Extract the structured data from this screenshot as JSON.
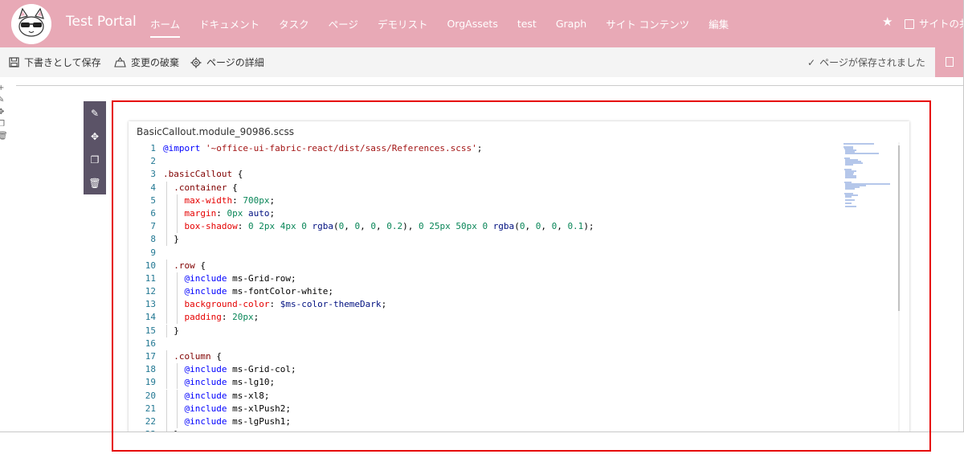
{
  "header": {
    "site_title": "Test Portal",
    "nav": [
      "ホーム",
      "ドキュメント",
      "タスク",
      "ページ",
      "デモリスト",
      "OrgAssets",
      "test",
      "Graph",
      "サイト コンテンツ",
      "編集"
    ],
    "active_nav": "ホーム",
    "share_label": "サイトの共",
    "brand_color": "#e8a9b6"
  },
  "commandbar": {
    "save_draft": "下書きとして保存",
    "discard": "変更の破棄",
    "page_details": "ページの詳細",
    "saved_status": "ページが保存されました"
  },
  "webpart": {
    "filename": "BasicCallout.module_90986.scss"
  },
  "code_lines": [
    [
      [
        "at",
        "@import"
      ],
      [
        "plain",
        " "
      ],
      [
        "str",
        "'~office-ui-fabric-react/dist/sass/References.scss'"
      ],
      [
        "plain",
        ";"
      ]
    ],
    [],
    [
      [
        "sel",
        ".basicCallout"
      ],
      [
        "plain",
        " {"
      ]
    ],
    [
      [
        "plain",
        "  "
      ],
      [
        "sel",
        ".container"
      ],
      [
        "plain",
        " {"
      ]
    ],
    [
      [
        "plain",
        "    "
      ],
      [
        "prop",
        "max-width"
      ],
      [
        "plain",
        ": "
      ],
      [
        "num",
        "700px"
      ],
      [
        "plain",
        ";"
      ]
    ],
    [
      [
        "plain",
        "    "
      ],
      [
        "prop",
        "margin"
      ],
      [
        "plain",
        ": "
      ],
      [
        "num",
        "0px"
      ],
      [
        "plain",
        " "
      ],
      [
        "var",
        "auto"
      ],
      [
        "plain",
        ";"
      ]
    ],
    [
      [
        "plain",
        "    "
      ],
      [
        "prop",
        "box-shadow"
      ],
      [
        "plain",
        ": "
      ],
      [
        "num",
        "0 2px 4px 0"
      ],
      [
        "plain",
        " "
      ],
      [
        "var",
        "rgba"
      ],
      [
        "plain",
        "("
      ],
      [
        "num",
        "0"
      ],
      [
        "plain",
        ", "
      ],
      [
        "num",
        "0"
      ],
      [
        "plain",
        ", "
      ],
      [
        "num",
        "0"
      ],
      [
        "plain",
        ", "
      ],
      [
        "num",
        "0.2"
      ],
      [
        "plain",
        "), "
      ],
      [
        "num",
        "0 25px 50px 0"
      ],
      [
        "plain",
        " "
      ],
      [
        "var",
        "rgba"
      ],
      [
        "plain",
        "("
      ],
      [
        "num",
        "0"
      ],
      [
        "plain",
        ", "
      ],
      [
        "num",
        "0"
      ],
      [
        "plain",
        ", "
      ],
      [
        "num",
        "0"
      ],
      [
        "plain",
        ", "
      ],
      [
        "num",
        "0.1"
      ],
      [
        "plain",
        ");"
      ]
    ],
    [
      [
        "plain",
        "  }"
      ]
    ],
    [],
    [
      [
        "plain",
        "  "
      ],
      [
        "sel",
        ".row"
      ],
      [
        "plain",
        " {"
      ]
    ],
    [
      [
        "plain",
        "    "
      ],
      [
        "at",
        "@include"
      ],
      [
        "plain",
        " ms-Grid-row;"
      ]
    ],
    [
      [
        "plain",
        "    "
      ],
      [
        "at",
        "@include"
      ],
      [
        "plain",
        " ms-fontColor-white;"
      ]
    ],
    [
      [
        "plain",
        "    "
      ],
      [
        "prop",
        "background-color"
      ],
      [
        "plain",
        ": "
      ],
      [
        "var",
        "$ms-color-themeDark"
      ],
      [
        "plain",
        ";"
      ]
    ],
    [
      [
        "plain",
        "    "
      ],
      [
        "prop",
        "padding"
      ],
      [
        "plain",
        ": "
      ],
      [
        "num",
        "20px"
      ],
      [
        "plain",
        ";"
      ]
    ],
    [
      [
        "plain",
        "  }"
      ]
    ],
    [],
    [
      [
        "plain",
        "  "
      ],
      [
        "sel",
        ".column"
      ],
      [
        "plain",
        " {"
      ]
    ],
    [
      [
        "plain",
        "    "
      ],
      [
        "at",
        "@include"
      ],
      [
        "plain",
        " ms-Grid-col;"
      ]
    ],
    [
      [
        "plain",
        "    "
      ],
      [
        "at",
        "@include"
      ],
      [
        "plain",
        " ms-lg10;"
      ]
    ],
    [
      [
        "plain",
        "    "
      ],
      [
        "at",
        "@include"
      ],
      [
        "plain",
        " ms-xl8;"
      ]
    ],
    [
      [
        "plain",
        "    "
      ],
      [
        "at",
        "@include"
      ],
      [
        "plain",
        " ms-xlPush2;"
      ]
    ],
    [
      [
        "plain",
        "    "
      ],
      [
        "at",
        "@include"
      ],
      [
        "plain",
        " ms-lgPush1;"
      ]
    ],
    [
      [
        "plain",
        "  }"
      ]
    ]
  ],
  "highlight_color": "#e60000"
}
